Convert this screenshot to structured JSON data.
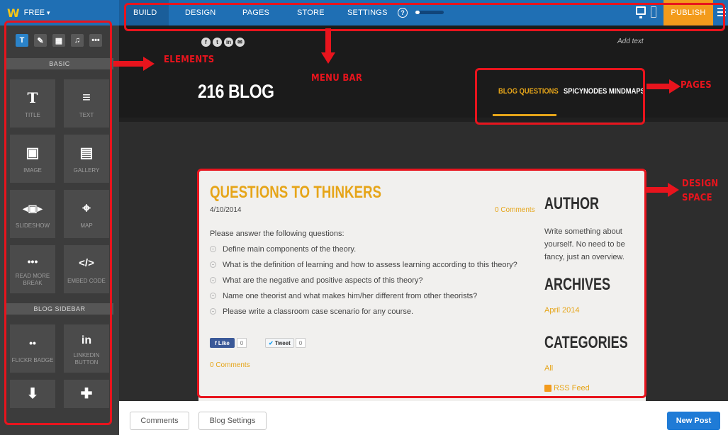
{
  "plan": {
    "logo": "W",
    "label": "FREE"
  },
  "sidebar": {
    "tools": [
      {
        "glyph": "T",
        "name": "text-tool"
      },
      {
        "glyph": "✎",
        "name": "pencil-tool"
      },
      {
        "glyph": "▦",
        "name": "layout-tool"
      },
      {
        "glyph": "♫",
        "name": "media-tool"
      },
      {
        "glyph": "•••",
        "name": "more-tool"
      }
    ],
    "basic_header": "BASIC",
    "basic_items": [
      {
        "label": "TITLE",
        "icon": "T"
      },
      {
        "label": "TEXT",
        "icon": "≡"
      },
      {
        "label": "IMAGE",
        "icon": "▣"
      },
      {
        "label": "GALLERY",
        "icon": "▤"
      },
      {
        "label": "SLIDESHOW",
        "icon": "◂▣▸"
      },
      {
        "label": "MAP",
        "icon": "⌖"
      },
      {
        "label": "READ MORE BREAK",
        "icon": "•••"
      },
      {
        "label": "EMBED CODE",
        "icon": "</>"
      }
    ],
    "blog_header": "BLOG SIDEBAR",
    "blog_items": [
      {
        "label": "FLICKR BADGE",
        "icon": "••"
      },
      {
        "label": "LINKEDIN BUTTON",
        "icon": "in"
      },
      {
        "label": "",
        "icon": "⬇"
      },
      {
        "label": "",
        "icon": "✚"
      }
    ]
  },
  "menu": {
    "items": [
      "BUILD",
      "DESIGN",
      "PAGES",
      "STORE",
      "SETTINGS"
    ],
    "help": "?",
    "progress": 0.15,
    "publish": "PUBLISH"
  },
  "site": {
    "social": [
      "f",
      "t",
      "in",
      "✉"
    ],
    "add_text": "Add text",
    "title": "216 BLOG",
    "nav": [
      "BLOG QUESTIONS",
      "SPICYNODES MINDMAPS"
    ]
  },
  "post": {
    "title": "QUESTIONS TO THINKERS",
    "date": "4/10/2014",
    "comments_count": "0 Comments",
    "intro": "Please answer the following questions:",
    "questions": [
      "Define main components of the theory.",
      "What is the definition of learning and how to assess learning according to this theory?",
      "What are the negative and positive aspects of this theory?",
      "Name one theorist and what makes him/her different from other theorists?",
      "Please write a classroom case scenario for any course."
    ],
    "like_label": "Like",
    "like_count": "0",
    "tweet_label": "Tweet",
    "tweet_count": "0",
    "comments_link": "0 Comments"
  },
  "blog_sidebar": {
    "author_heading": "AUTHOR",
    "author_text": "Write something about yourself. No need to be fancy, just an overview.",
    "archives_heading": "ARCHIVES",
    "archive_item": "April 2014",
    "categories_heading": "CATEGORIES",
    "category_item": "All",
    "rss": "RSS Feed"
  },
  "bottom": {
    "comments": "Comments",
    "blog_settings": "Blog Settings",
    "new_post": "New Post"
  },
  "annotations": {
    "elements": "ELEMENTS",
    "menu_bar": "MENU BAR",
    "pages": "PAGES",
    "design_space": "DESIGN SPACE"
  },
  "colors": {
    "accent_blue": "#1f6fb4",
    "publish": "#f39b1c",
    "gold": "#e6a519",
    "annotation": "#e8141d"
  }
}
